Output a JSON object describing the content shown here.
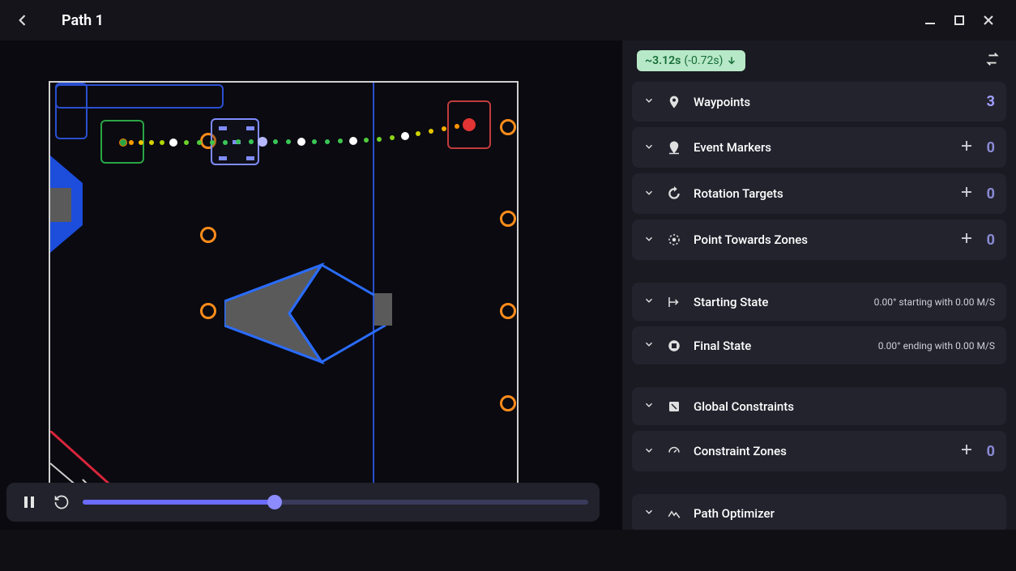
{
  "titlebar": {
    "title": "Path 1"
  },
  "time_chip": {
    "estimate": "~3.12s",
    "delta": "(-0.72s)"
  },
  "sections": {
    "waypoints": {
      "label": "Waypoints",
      "count": "3"
    },
    "event_markers": {
      "label": "Event Markers",
      "count": "0"
    },
    "rotation_targets": {
      "label": "Rotation Targets",
      "count": "0"
    },
    "point_towards": {
      "label": "Point Towards Zones",
      "count": "0"
    },
    "starting_state": {
      "label": "Starting State",
      "state_text": "0.00° starting with 0.00 M/S"
    },
    "final_state": {
      "label": "Final State",
      "state_text": "0.00° ending with 0.00 M/S"
    },
    "global_constraints": {
      "label": "Global Constraints"
    },
    "constraint_zones": {
      "label": "Constraint Zones",
      "count": "0"
    },
    "path_optimizer": {
      "label": "Path Optimizer"
    }
  },
  "playback": {
    "progress_pct": 38
  },
  "colors": {
    "accent": "#2a4fd0",
    "gamepiece": "#ff8c1a",
    "start_rect": "#2aa544",
    "end_rect": "#c13b3b"
  }
}
